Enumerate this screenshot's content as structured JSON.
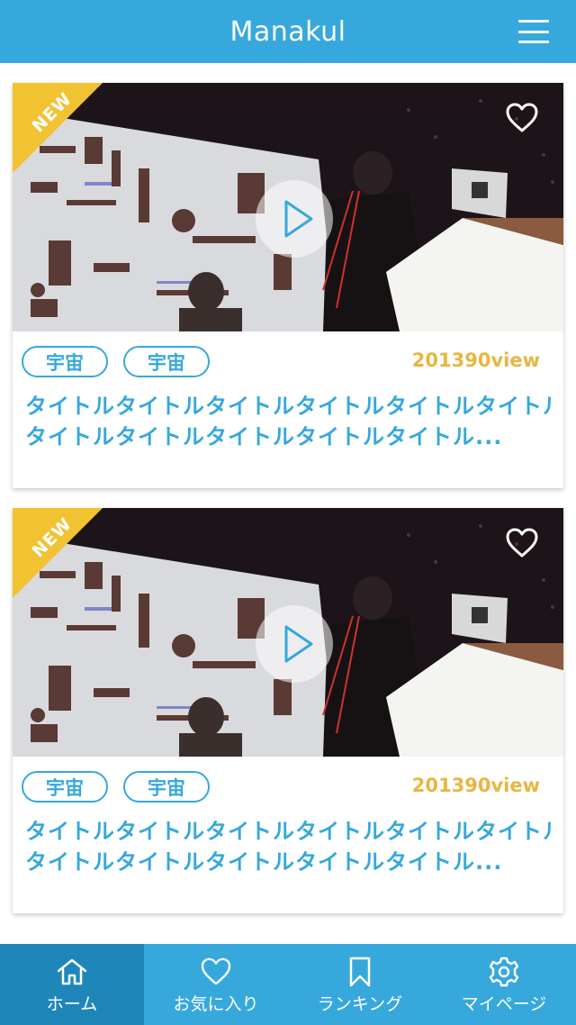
{
  "header": {
    "title": "Manakul",
    "menu_icon": "hamburger-menu-icon"
  },
  "cards": [
    {
      "badge": "NEW",
      "tags": [
        "宇宙",
        "宇宙"
      ],
      "views": "201390view",
      "title_line1": "タイトルタイトルタイトルタイトルタイトルタイトル",
      "title_line2": "タイトルタイトルタイトルタイトルタイトル...",
      "favorite_icon": "heart-outline-icon",
      "play_icon": "play-icon"
    },
    {
      "badge": "NEW",
      "tags": [
        "宇宙",
        "宇宙"
      ],
      "views": "201390view",
      "title_line1": "タイトルタイトルタイトルタイトルタイトルタイトル",
      "title_line2": "タイトルタイトルタイトルタイトルタイトル...",
      "favorite_icon": "heart-outline-icon",
      "play_icon": "play-icon"
    }
  ],
  "tabbar": {
    "active_index": 0,
    "items": [
      {
        "label": "ホーム",
        "icon": "home-icon"
      },
      {
        "label": "お気に入り",
        "icon": "heart-icon"
      },
      {
        "label": "ランキング",
        "icon": "bookmark-icon"
      },
      {
        "label": "マイページ",
        "icon": "gear-icon"
      }
    ]
  },
  "colors": {
    "primary": "#36a8dc",
    "active_tab": "#1e86b8",
    "badge": "#f1c232",
    "views": "#e8b640"
  }
}
